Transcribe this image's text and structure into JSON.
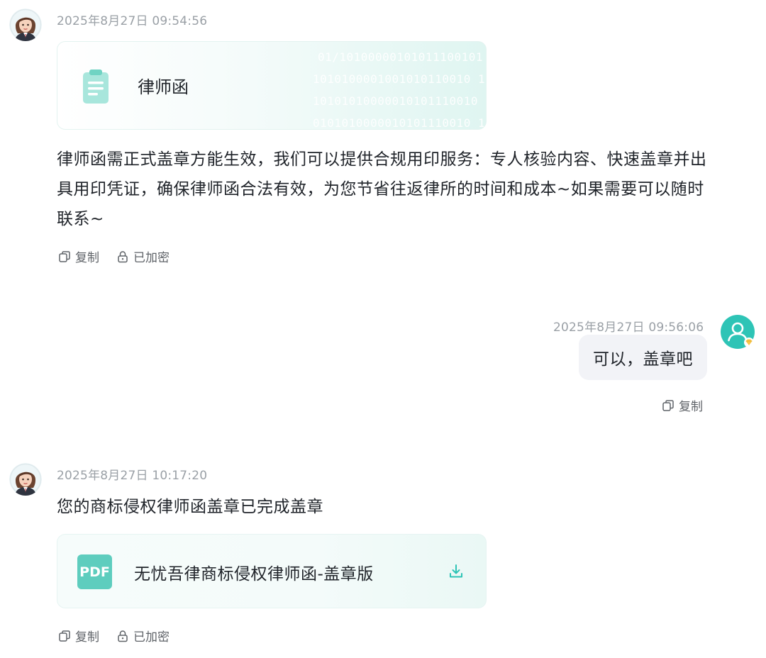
{
  "messages": [
    {
      "sender": "bot",
      "timestamp": "2025年8月27日 09:54:56",
      "doc_card": {
        "title": "律师函",
        "binary_lines": [
          "01/10100000101011100101",
          "1010100001001010110010 1",
          "10101010000010101110010 1",
          "0101010000010101110010 1"
        ]
      },
      "text": "律师函需正式盖章方能生效，我们可以提供合规用印服务：专人核验内容、快速盖章并出具用印凭证，确保律师函合法有效，为您节省往返律所的时间和成本~如果需要可以随时联系~",
      "actions": {
        "copy": "复制",
        "encrypted": "已加密"
      }
    },
    {
      "sender": "user",
      "timestamp": "2025年8月27日 09:56:06",
      "text": "可以，盖章吧",
      "actions": {
        "copy": "复制"
      }
    },
    {
      "sender": "bot",
      "timestamp": "2025年8月27日 10:17:20",
      "text": "您的商标侵权律师函盖章已完成盖章",
      "pdf_card": {
        "badge": "PDF",
        "title": "无忧吾律商标侵权律师函-盖章版"
      },
      "actions": {
        "copy": "复制",
        "encrypted": "已加密"
      }
    }
  ],
  "colors": {
    "accent": "#2ec4b6",
    "pdf_badge": "#5ecdbe",
    "timestamp": "#9aa0a6",
    "user_bubble": "#f2f3f7"
  },
  "icons": {
    "bot_avatar": "lawyer-avatar-icon",
    "user_avatar": "user-avatar-icon",
    "document": "clipboard-document-icon",
    "copy": "copy-icon",
    "lock": "lock-icon",
    "download": "download-icon"
  }
}
